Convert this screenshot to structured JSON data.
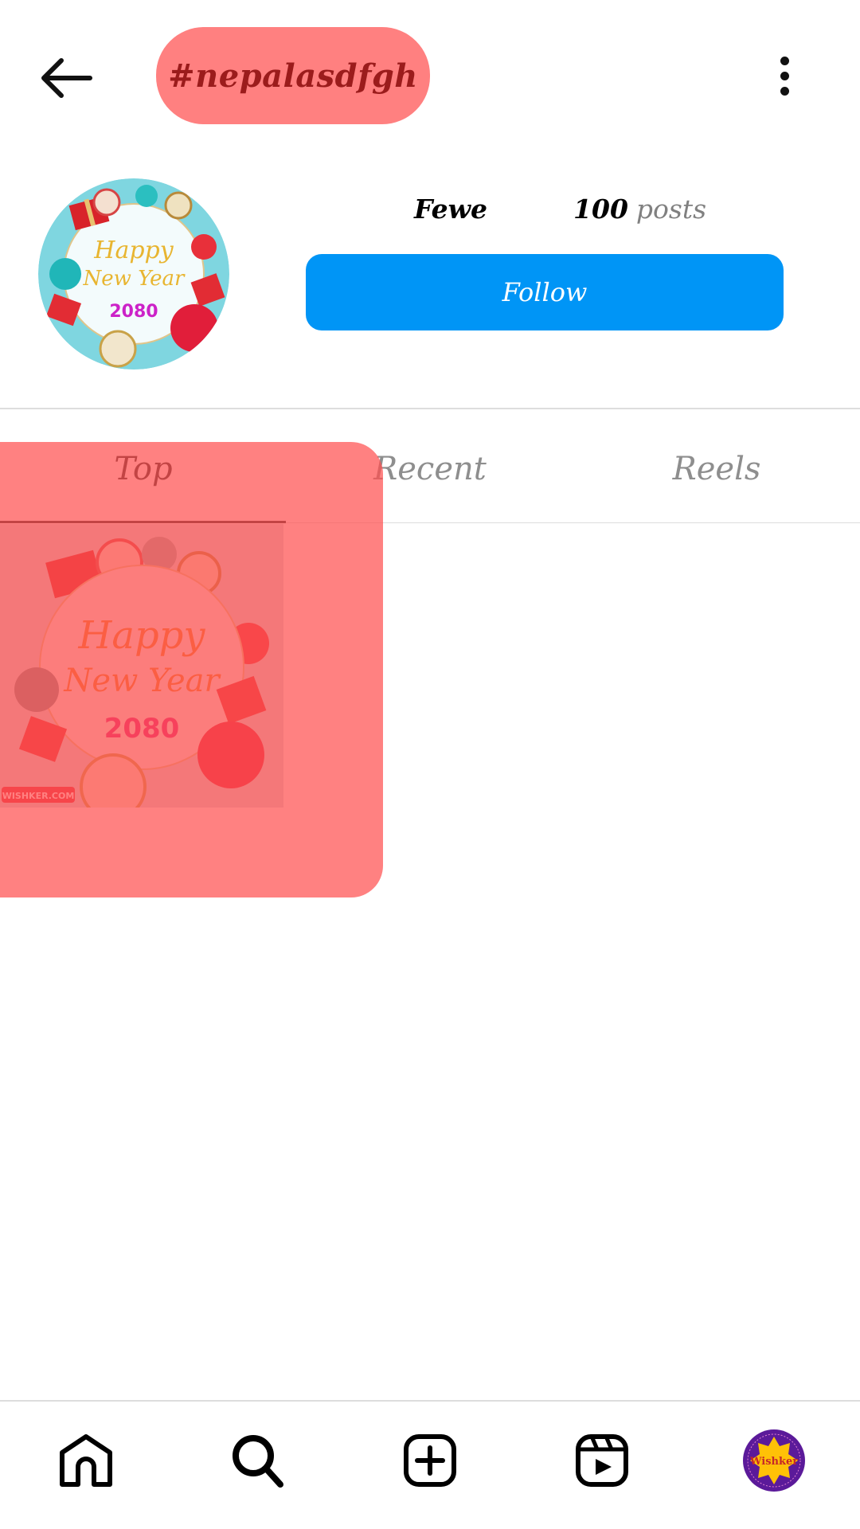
{
  "header": {
    "back_icon": "arrow-left-icon",
    "title": "#nepalasdfgh",
    "more_icon": "more-vertical-icon"
  },
  "hashtag_profile": {
    "avatar_image": "happy-new-year-2080-image",
    "avatar_text": {
      "line1": "Happy",
      "line2": "New Year",
      "year": "2080"
    },
    "name_partial": "Fewe",
    "post_count": "100",
    "post_label": "posts",
    "follow_label": "Follow"
  },
  "tabs": [
    {
      "label": "Top",
      "active": true
    },
    {
      "label": "Recent",
      "active": false
    },
    {
      "label": "Reels",
      "active": false
    }
  ],
  "grid": [
    {
      "image": "happy-new-year-2080-post",
      "text": {
        "line1": "Happy",
        "line2": "New Year",
        "year": "2080",
        "watermark": "WISHKER.COM"
      }
    }
  ],
  "bottom_nav": [
    {
      "name": "home",
      "icon": "home-icon"
    },
    {
      "name": "search",
      "icon": "search-icon",
      "active": true
    },
    {
      "name": "create",
      "icon": "plus-square-icon"
    },
    {
      "name": "reels",
      "icon": "reels-icon"
    },
    {
      "name": "profile",
      "icon": "profile-avatar",
      "avatar_text": "Wishker"
    }
  ],
  "colors": {
    "accent_blue": "#0095f6",
    "highlight_red": "#ff8080",
    "title_text": "#9b1c1c",
    "muted_text": "#8e8e8e"
  }
}
